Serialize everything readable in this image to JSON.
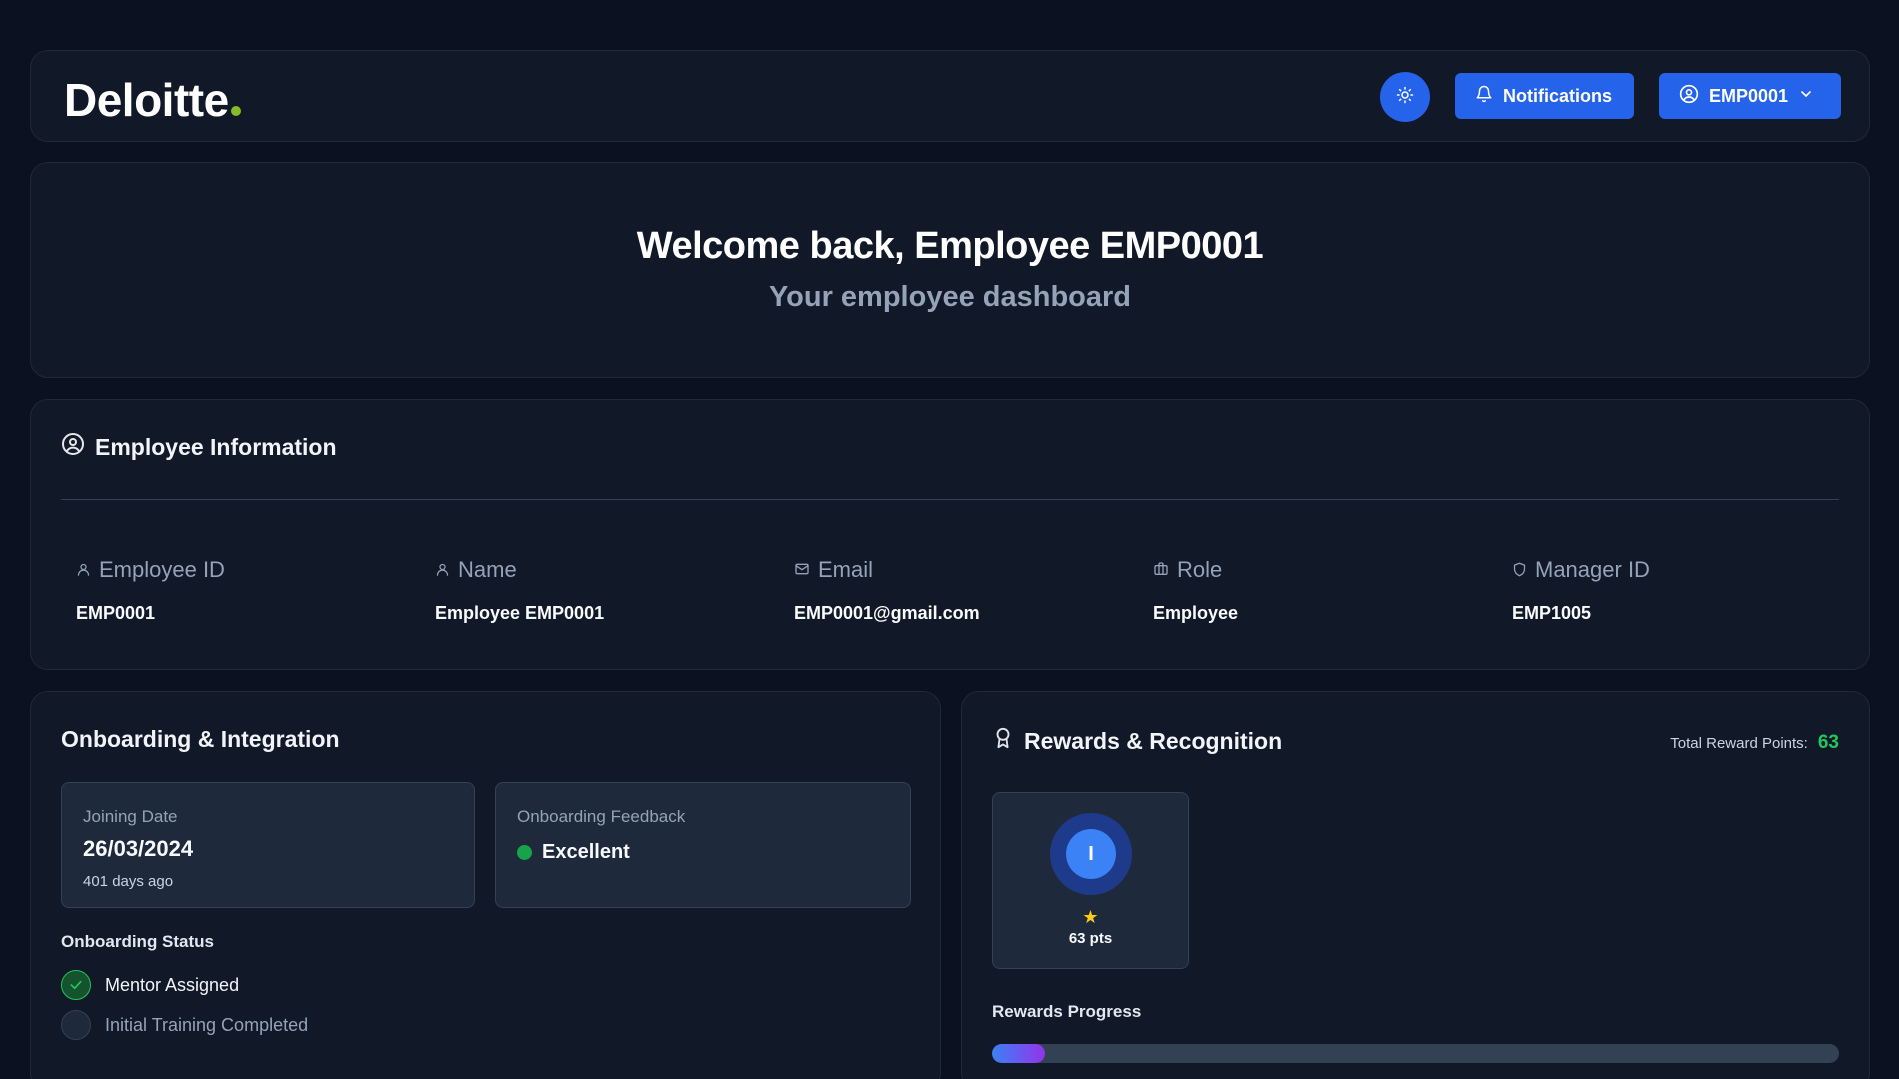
{
  "header": {
    "logo_text": "Deloitte",
    "logo_dot_color": "#86bc25",
    "theme_icon": "sun-icon",
    "notifications_label": "Notifications",
    "user_label": "EMP0001"
  },
  "welcome": {
    "title": "Welcome back, Employee EMP0001",
    "subtitle": "Your employee dashboard"
  },
  "employee_info": {
    "title": "Employee Information",
    "fields": [
      {
        "label": "Employee ID",
        "value": "EMP0001",
        "icon": "user-icon"
      },
      {
        "label": "Name",
        "value": "Employee EMP0001",
        "icon": "user-icon"
      },
      {
        "label": "Email",
        "value": "EMP0001@gmail.com",
        "icon": "mail-icon"
      },
      {
        "label": "Role",
        "value": "Employee",
        "icon": "briefcase-icon"
      },
      {
        "label": "Manager ID",
        "value": "EMP1005",
        "icon": "shield-icon"
      }
    ]
  },
  "onboarding": {
    "title": "Onboarding & Integration",
    "joining_label": "Joining Date",
    "joining_date": "26/03/2024",
    "joining_ago": "401 days ago",
    "feedback_label": "Onboarding Feedback",
    "feedback_value": "Excellent",
    "status_title": "Onboarding Status",
    "status_items": [
      {
        "label": "Mentor Assigned",
        "done": true
      },
      {
        "label": "Initial Training Completed",
        "done": false
      }
    ]
  },
  "rewards": {
    "title": "Rewards & Recognition",
    "total_label": "Total Reward Points:",
    "total_value": "63",
    "badge_letter": "I",
    "badge_points": "63 pts",
    "progress_label": "Rewards Progress",
    "progress_fraction": 0.063
  },
  "colors": {
    "accent": "#2563eb",
    "success": "#22c55e",
    "background": "#0b1120",
    "card": "#111827"
  }
}
